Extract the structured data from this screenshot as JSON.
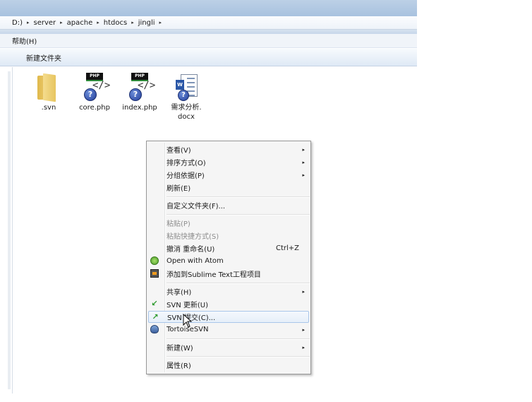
{
  "address": {
    "crumbs": [
      "D:)",
      "server",
      "apache",
      "htdocs",
      "jingli"
    ]
  },
  "menubar": {
    "help": "帮助(H)"
  },
  "toolbar": {
    "new_folder": "新建文件夹"
  },
  "files": [
    {
      "name": ".svn",
      "type": "folder"
    },
    {
      "name": "core.php",
      "type": "php",
      "badge": "PHP"
    },
    {
      "name": "index.php",
      "type": "php",
      "badge": "PHP"
    },
    {
      "name_line1": "需求分析.",
      "name_line2": "docx",
      "type": "docx"
    }
  ],
  "context_menu": {
    "view": "查看(V)",
    "sort": "排序方式(O)",
    "group": "分组依据(P)",
    "refresh": "刷新(E)",
    "customize": "自定义文件夹(F)...",
    "paste": "粘贴(P)",
    "paste_shortcut": "粘贴快捷方式(S)",
    "undo": "撤消 重命名(U)",
    "undo_shortcut": "Ctrl+Z",
    "open_atom": "Open with Atom",
    "sublime": "添加到Sublime Text工程项目",
    "share": "共享(H)",
    "svn_update": "SVN 更新(U)",
    "svn_commit": "SVN 提交(C)...",
    "tortoise": "TortoiseSVN",
    "new": "新建(W)",
    "properties": "属性(R)"
  },
  "icons": {
    "submenu_arrow": "▸",
    "crumb_arrow": "▸",
    "svn_update": "↙",
    "svn_commit": "↗"
  }
}
